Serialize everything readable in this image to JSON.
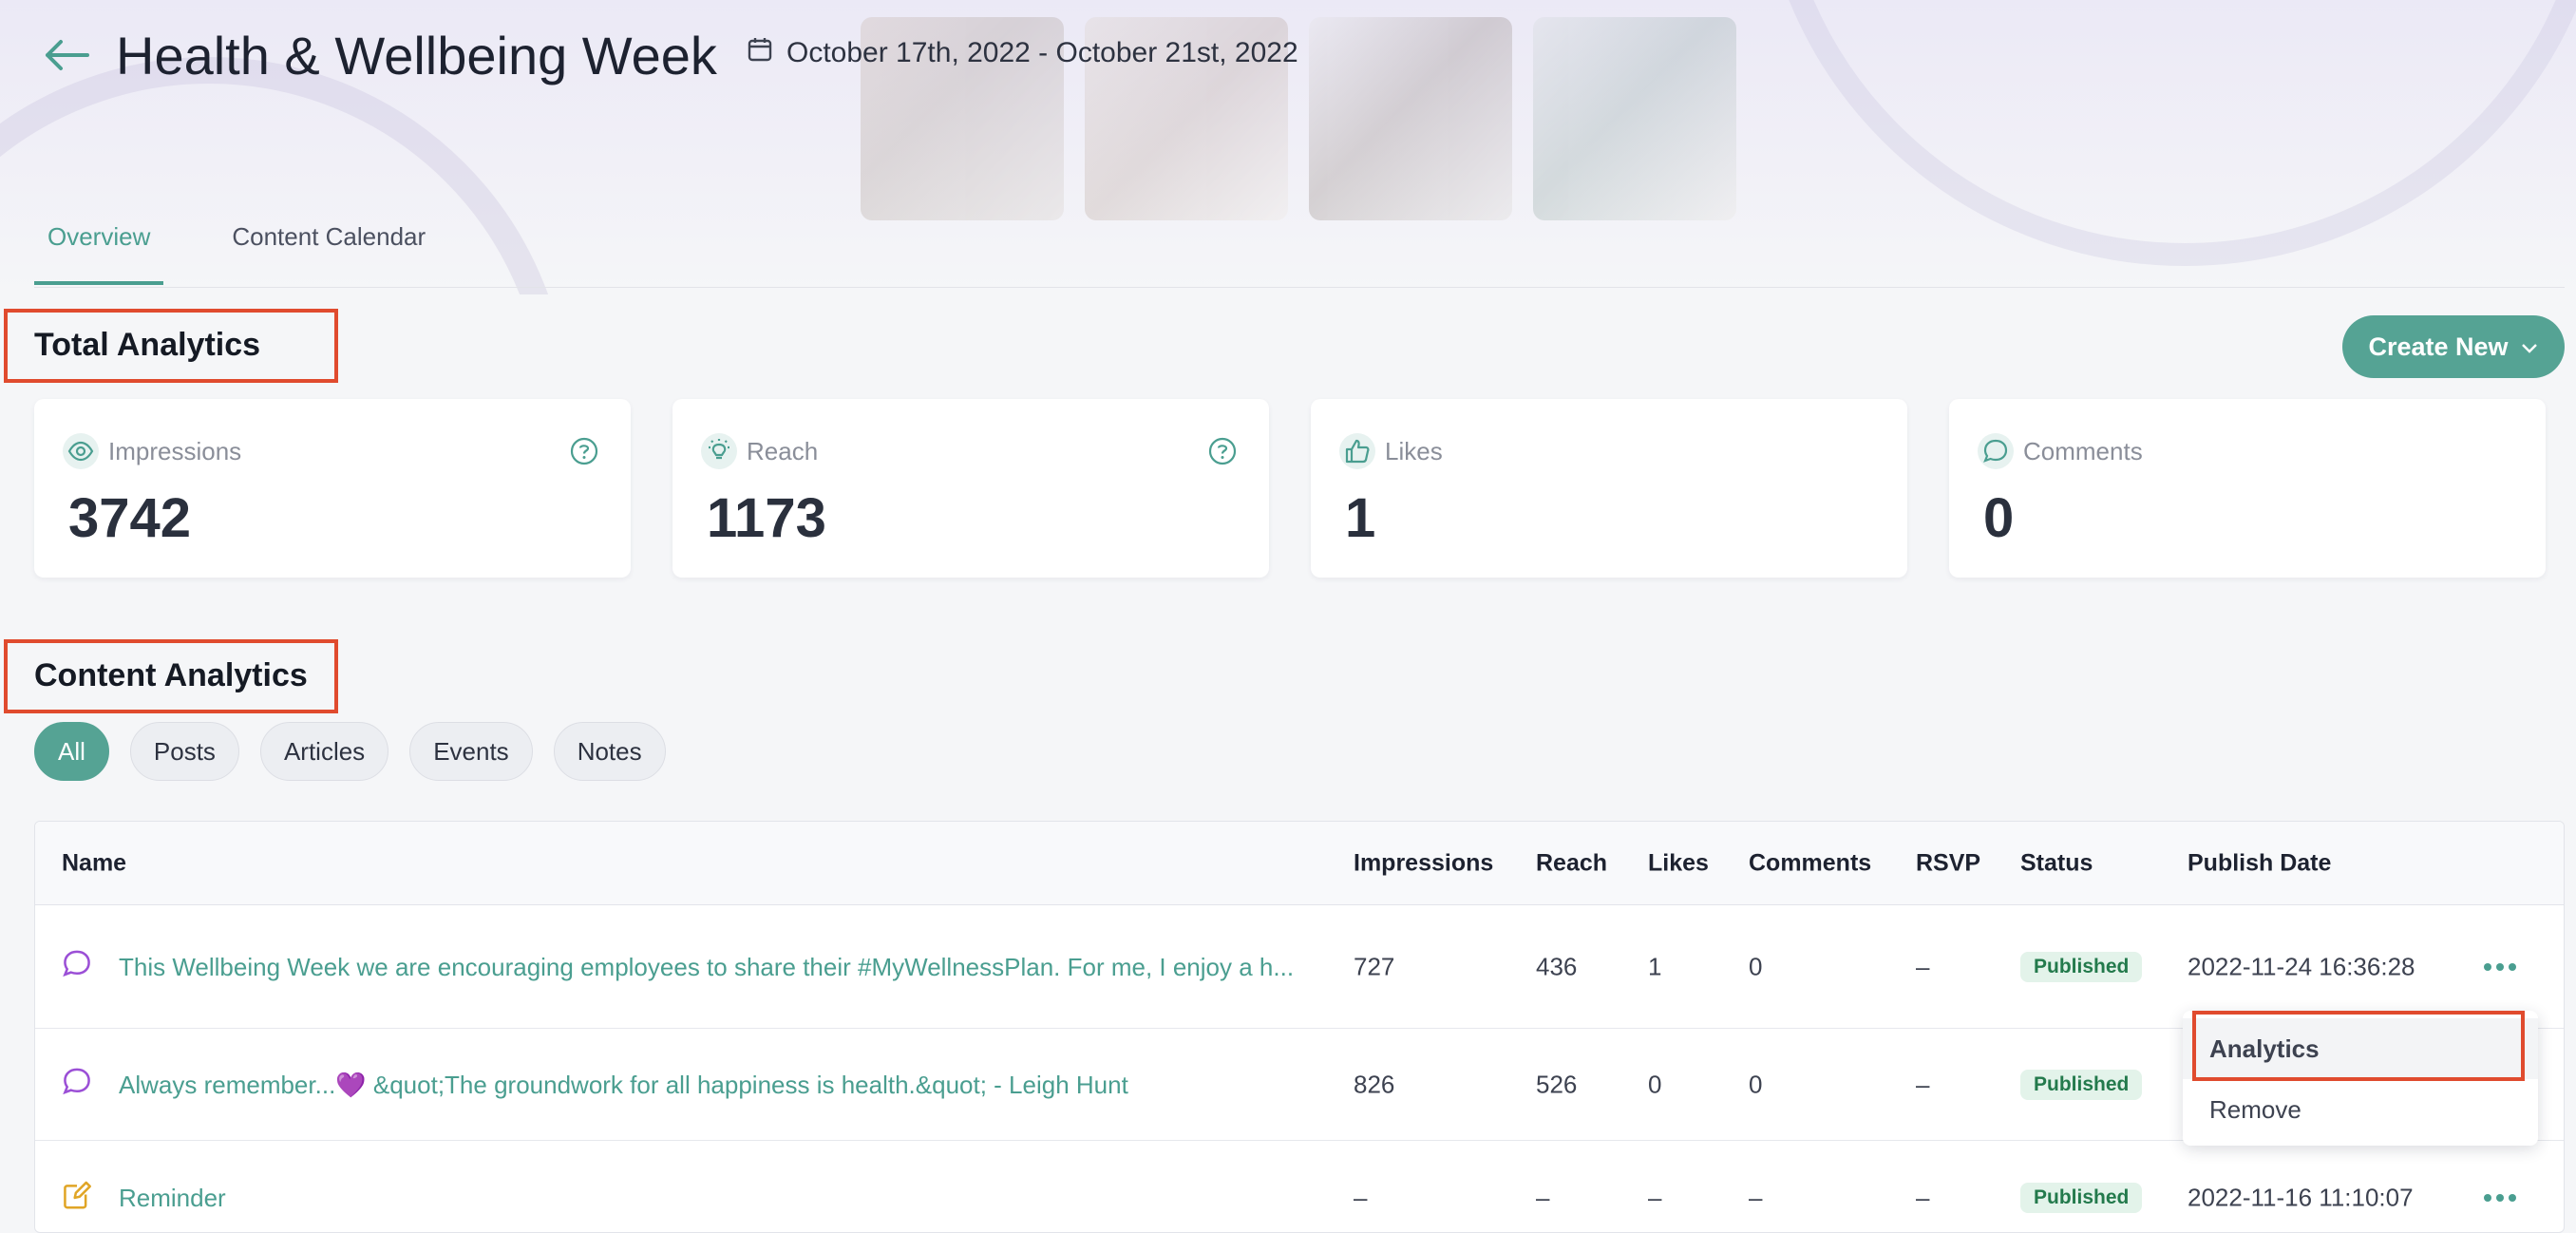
{
  "header": {
    "title": "Health & Wellbeing Week",
    "date_range": "October 17th, 2022 - October 21st, 2022"
  },
  "tabs": [
    {
      "label": "Overview",
      "active": true
    },
    {
      "label": "Content Calendar",
      "active": false
    }
  ],
  "total_analytics": {
    "title": "Total Analytics",
    "create_button": "Create New",
    "cards": [
      {
        "label": "Impressions",
        "value": "3742",
        "icon": "eye-icon",
        "help": true
      },
      {
        "label": "Reach",
        "value": "1173",
        "icon": "lightbulb-icon",
        "help": true
      },
      {
        "label": "Likes",
        "value": "1",
        "icon": "thumbs-up-icon",
        "help": false
      },
      {
        "label": "Comments",
        "value": "0",
        "icon": "chat-bubble-icon",
        "help": false
      }
    ]
  },
  "content_analytics": {
    "title": "Content Analytics",
    "filters": [
      {
        "label": "All",
        "active": true
      },
      {
        "label": "Posts",
        "active": false
      },
      {
        "label": "Articles",
        "active": false
      },
      {
        "label": "Events",
        "active": false
      },
      {
        "label": "Notes",
        "active": false
      }
    ],
    "columns": [
      "Name",
      "Impressions",
      "Reach",
      "Likes",
      "Comments",
      "RSVP",
      "Status",
      "Publish Date"
    ],
    "rows": [
      {
        "type_icon": "chat-bubble-icon",
        "name": "This Wellbeing Week we are encouraging employees to share their #MyWellnessPlan. For me, I enjoy a h...",
        "impressions": "727",
        "reach": "436",
        "likes": "1",
        "comments": "0",
        "rsvp": "–",
        "status": "Published",
        "publish_date": "2022-11-24 16:36:28"
      },
      {
        "type_icon": "chat-bubble-icon",
        "name": "Always remember...💜 &quot;The groundwork for all happiness is health.&quot; - Leigh Hunt",
        "impressions": "826",
        "reach": "526",
        "likes": "0",
        "comments": "0",
        "rsvp": "–",
        "status": "Published",
        "publish_date": ""
      },
      {
        "type_icon": "note-edit-icon",
        "name": "Reminder",
        "impressions": "–",
        "reach": "–",
        "likes": "–",
        "comments": "–",
        "rsvp": "–",
        "status": "Published",
        "publish_date": "2022-11-16 11:10:07"
      }
    ],
    "row_menu": {
      "items": [
        "Analytics",
        "Remove"
      ],
      "highlighted": "Analytics"
    }
  },
  "colors": {
    "accent": "#55a394",
    "highlight_box": "#e04b2e",
    "status_published_bg": "#e3f3ea"
  }
}
